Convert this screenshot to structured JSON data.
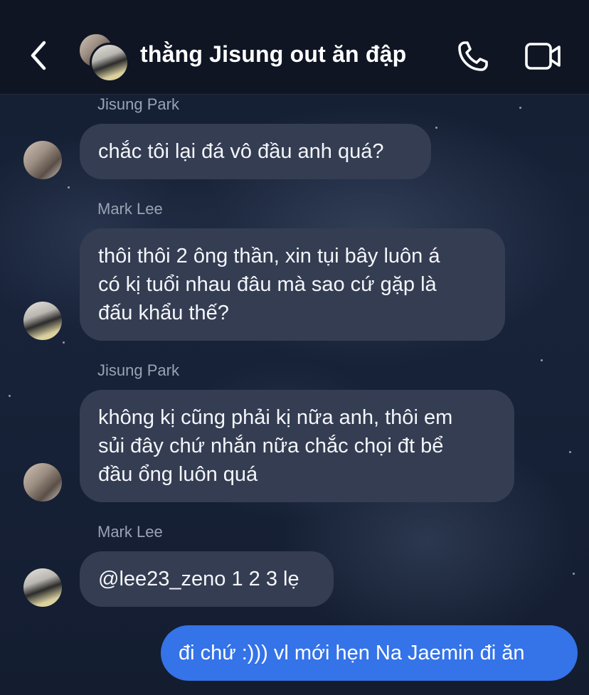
{
  "header": {
    "title": "thằng Jisung out ăn đập",
    "back_icon": "chevron-left-icon",
    "call_icon": "phone-icon",
    "video_icon": "video-camera-icon"
  },
  "messages": [
    {
      "sender": "Jisung Park",
      "lines": [
        "chắc tôi lại đá vô đầu anh quá?"
      ]
    },
    {
      "sender": "Mark Lee",
      "lines": [
        "thôi thôi 2 ông thần, xin tụi bây luôn á",
        "có kị tuổi nhau đâu mà sao cứ gặp là",
        "đấu khẩu thế?"
      ]
    },
    {
      "sender": "Jisung Park",
      "lines": [
        "không kị cũng phải kị nữa anh, thôi em",
        "sủi đây chứ nhắn nữa chắc chọi đt bể",
        "đầu ổng luôn quá"
      ]
    },
    {
      "sender": "Mark Lee",
      "lines": [
        "@lee23_zeno 1 2 3 lẹ"
      ]
    }
  ],
  "my_message": {
    "text": "đi chứ :))) vl mới hẹn Na Jaemin đi ăn"
  },
  "colors": {
    "header_bg": "#0f1523",
    "incoming_bubble": "#343d52",
    "outgoing_bubble": "#3473e8",
    "sender_name": "#9aa3b4"
  }
}
